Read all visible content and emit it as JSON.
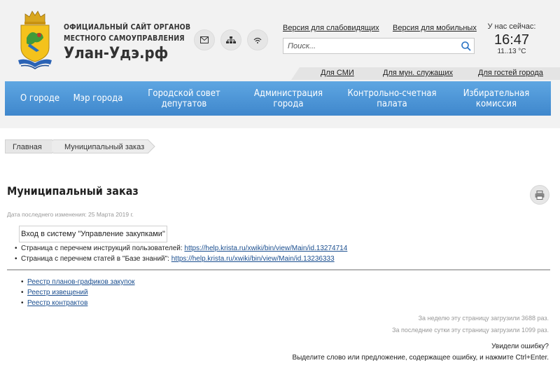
{
  "site": {
    "line1": "ОФИЦИАЛЬНЫЙ САЙТ ОРГАНОВ",
    "line2": "МЕСТНОГО САМОУПРАВЛЕНИЯ",
    "name": "Улан-Удэ.рф"
  },
  "header": {
    "icons": [
      "mail-icon",
      "sitemap-icon",
      "rss-icon"
    ],
    "link_low_vision": "Версия для слабовидящих",
    "link_mobile": "Версия для мобильных",
    "search_placeholder": "Поиск...",
    "now_label": "У нас сейчас:",
    "time": "16:47",
    "temperature": "11..13 °С",
    "sub_links": [
      "Для СМИ",
      "Для мун. служащих",
      "Для гостей города"
    ]
  },
  "nav": {
    "items": [
      "О городе",
      "Мэр города",
      "Городской совет депутатов",
      "Администрация города",
      "Контрольно-счетная палата",
      "Избирательная комиссия"
    ]
  },
  "breadcrumb": [
    "Главная",
    "Муниципальный заказ"
  ],
  "page": {
    "title": "Муниципальный заказ",
    "updated": "Дата последнего изменения: 25 Марта 2019 г.",
    "login_button": "Вход в систему \"Управление закупками\"",
    "instr_label": "Страница с перечнем инструкций пользователей: ",
    "instr_url": "https://help.krista.ru/xwiki/bin/view/Main/id.13274714",
    "kb_label": "Страница с перечнем статей в \"Базе знаний\": ",
    "kb_url": "https://help.krista.ru/xwiki/bin/view/Main/id.13236333",
    "registries": [
      "Реестр планов-графиков закупок",
      "Реестр извещений",
      "Реестр контрактов"
    ],
    "stat_week": "За неделю эту страницу загрузили 3688 раз.",
    "stat_day": "За последние сутки эту страницу загрузили 1099 раз.",
    "error_title": "Увидели ошибку?",
    "error_text": "Выделите слово или предложение, содержащее ошибку, и нажмите Ctrl+Enter."
  },
  "colors": {
    "nav_top": "#5ea6e2",
    "nav_bottom": "#3f87cc",
    "link": "#1a4e8f",
    "header_bg": "#f2f2f2"
  }
}
